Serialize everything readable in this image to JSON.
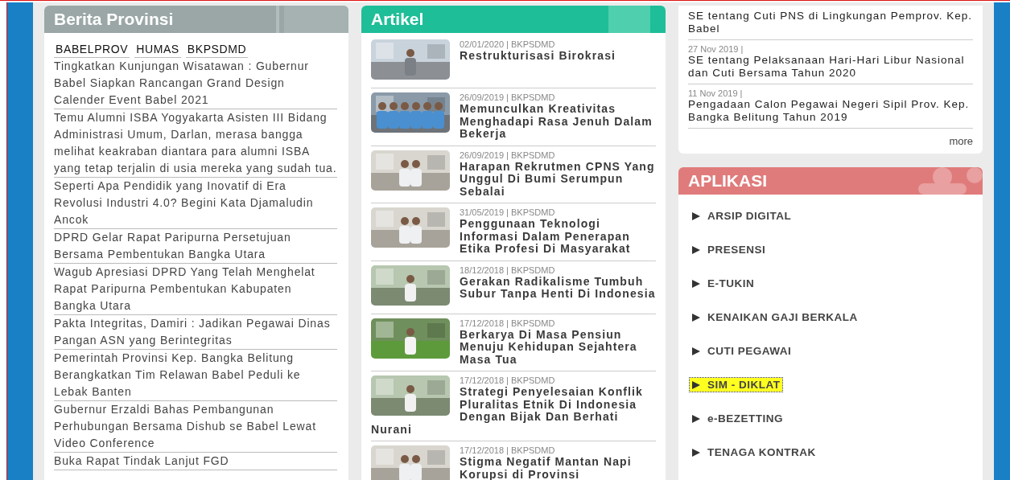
{
  "berita": {
    "title": "Berita Provinsi",
    "tabs": [
      {
        "label": "BABELPROV",
        "selected": false
      },
      {
        "label": "HUMAS",
        "selected": false
      },
      {
        "label": "BKPSDMD",
        "selected": false
      }
    ],
    "items": [
      "Tingkatkan Kunjungan Wisatawan : Gubernur Babel Siapkan Rancangan Grand Design Calender Event Babel 2021",
      "Temu Alumni ISBA Yogyakarta Asisten III Bidang Administrasi Umum, Darlan, merasa bangga melihat keakraban diantara para alumni ISBA yang tetap terjalin di usia mereka yang sudah tua.",
      "Seperti Apa Pendidik yang Inovatif di Era Revolusi Industri 4.0? Begini Kata Djamaludin Ancok",
      "DPRD Gelar Rapat Paripurna Persetujuan Bersama Pembentukan Bangka Utara",
      "Wagub Apresiasi DPRD Yang Telah Menghelat Rapat Paripurna Pembentukan Kabupaten Bangka Utara",
      "Pakta Integritas, Damiri : Jadikan Pegawai Dinas Pangan ASN yang Berintegritas",
      "Pemerintah Provinsi Kep. Bangka Belitung Berangkatkan Tim Relawan Babel Peduli ke Lebak Banten",
      "Gubernur Erzaldi Bahas Pembangunan Perhubungan Bersama Dishub se Babel Lewat Video Conference",
      "Buka Rapat Tindak Lanjut FGD"
    ]
  },
  "artikel": {
    "title": "Artikel",
    "items": [
      {
        "meta": "02/01/2020 | BKPSDMD",
        "title": "Restrukturisasi Birokrasi",
        "kind": "portrait"
      },
      {
        "meta": "26/09/2019 | BKPSDMD",
        "title": "Memunculkan Kreativitas Menghadapi Rasa Jenuh Dalam Bekerja",
        "kind": "group"
      },
      {
        "meta": "26/09/2019 | BKPSDMD",
        "title": "Harapan Rekrutmen CPNS Yang Unggul Di Bumi Serumpun Sebalai",
        "kind": "office"
      },
      {
        "meta": "31/05/2019 | BKPSDMD",
        "title": "Penggunaan Teknologi Informasi Dalam Penerapan Etika Profesi Di Masyarakat",
        "kind": "office"
      },
      {
        "meta": "18/12/2018 | BKPSDMD",
        "title": "Gerakan Radikalisme Tumbuh Subur Tanpa Henti Di Indonesia",
        "kind": "outdoor"
      },
      {
        "meta": "17/12/2018 | BKPSDMD",
        "title": "Berkarya Di Masa Pensiun Menuju Kehidupan Sejahtera Masa Tua",
        "kind": "field"
      },
      {
        "meta": "17/12/2018 | BKPSDMD",
        "title": "Strategi Penyelesaian Konflik Pluralitas Etnik Di Indonesia Dengan Bijak Dan Berhati Nurani",
        "kind": "outdoor"
      },
      {
        "meta": "17/12/2018 | BKPSDMD",
        "title": "Stigma Negatif Mantan Napi Korupsi di Provinsi",
        "kind": "office"
      }
    ]
  },
  "pengumuman": {
    "items": [
      {
        "title": "SE tentang Cuti PNS di Lingkungan Pemprov. Kep. Babel"
      },
      {
        "date": "27 Nov 2019 |",
        "title": "SE tentang Pelaksanaan Hari-Hari Libur Nasional dan Cuti Bersama Tahun 2020"
      },
      {
        "date": "11 Nov 2019 |",
        "title": "Pengadaan Calon Pegawai Negeri Sipil Prov. Kep. Bangka Belitung Tahun 2019"
      }
    ],
    "more": "more"
  },
  "aplikasi": {
    "title": "APLIKASI",
    "items": [
      {
        "label": "ARSIP DIGITAL",
        "selected": false
      },
      {
        "label": "PRESENSI",
        "selected": false
      },
      {
        "label": "E-TUKIN",
        "selected": false
      },
      {
        "label": "KENAIKAN GAJI BERKALA",
        "selected": false
      },
      {
        "label": "CUTI PEGAWAI",
        "selected": false
      },
      {
        "label": "SIM - DIKLAT",
        "selected": true
      },
      {
        "label": "e-BEZETTING",
        "selected": false
      },
      {
        "label": "TENAGA KONTRAK",
        "selected": false
      }
    ]
  }
}
